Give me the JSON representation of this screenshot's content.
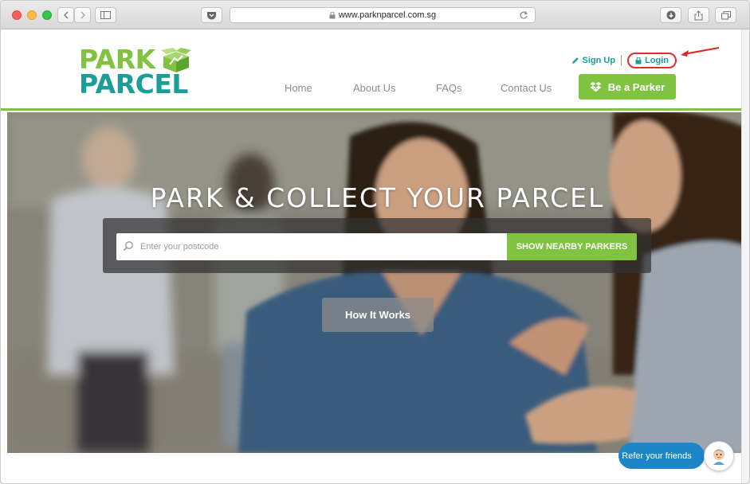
{
  "browser": {
    "url": "www.parknparcel.com.sg"
  },
  "brand": {
    "logo_line1": "PARK",
    "logo_line2": "PARCEL",
    "green": "#80c341",
    "teal": "#1d9d98"
  },
  "topnav": {
    "signup_label": "Sign Up",
    "login_label": "Login"
  },
  "mainnav": {
    "items": [
      {
        "label": "Home"
      },
      {
        "label": "About Us"
      },
      {
        "label": "FAQs"
      },
      {
        "label": "Contact Us"
      }
    ],
    "cta_label": "Be a Parker"
  },
  "hero": {
    "title": "PARK & COLLECT YOUR PARCEL",
    "search_placeholder": "Enter your postcode",
    "search_button": "SHOW NEARBY PARKERS",
    "how_button": "How It Works"
  },
  "refer": {
    "label": "Refer your friends"
  },
  "icons": {
    "back": "chevron-left-icon",
    "forward": "chevron-right-icon",
    "sidebar": "sidebar-icon",
    "pocket": "pocket-icon",
    "lock": "lock-icon",
    "reload": "reload-icon",
    "download": "download-icon",
    "share": "share-icon",
    "tabs": "tabs-icon",
    "pencil": "pencil-icon",
    "search": "search-icon",
    "dropbox": "dropbox-icon"
  }
}
